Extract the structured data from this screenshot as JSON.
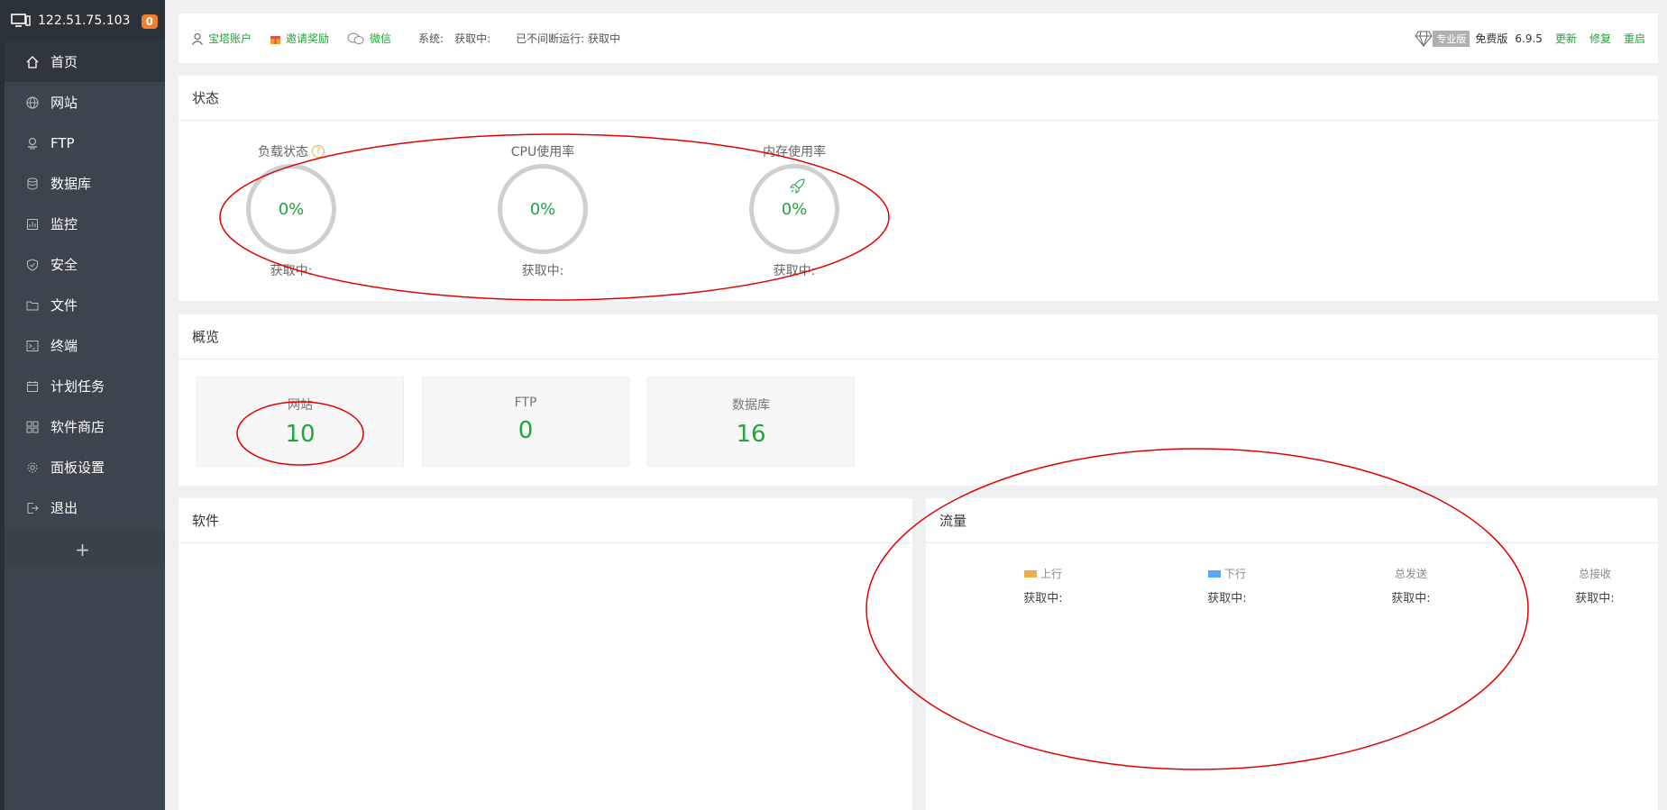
{
  "sidebar": {
    "ip": "122.51.75.103",
    "badge": "0",
    "items": [
      {
        "label": "首页",
        "icon": "home-icon"
      },
      {
        "label": "网站",
        "icon": "globe-icon"
      },
      {
        "label": "FTP",
        "icon": "ftp-icon"
      },
      {
        "label": "数据库",
        "icon": "database-icon"
      },
      {
        "label": "监控",
        "icon": "monitor-icon"
      },
      {
        "label": "安全",
        "icon": "shield-icon"
      },
      {
        "label": "文件",
        "icon": "folder-icon"
      },
      {
        "label": "终端",
        "icon": "terminal-icon"
      },
      {
        "label": "计划任务",
        "icon": "calendar-icon"
      },
      {
        "label": "软件商店",
        "icon": "apps-icon"
      },
      {
        "label": "面板设置",
        "icon": "gear-icon"
      },
      {
        "label": "退出",
        "icon": "logout-icon"
      }
    ],
    "add_label": "+"
  },
  "topbar": {
    "account": "宝塔账户",
    "invite": "邀请奖励",
    "wechat": "微信",
    "system_label": "系统:",
    "system_value": "获取中:",
    "uptime": "已不间断运行: 获取中",
    "pro": "专业版",
    "free": "免费版",
    "version": "6.9.5",
    "update": "更新",
    "repair": "修复",
    "restart": "重启"
  },
  "status": {
    "title": "状态",
    "gauges": [
      {
        "title": "负载状态",
        "value": "0%",
        "sub": "获取中:"
      },
      {
        "title": "CPU使用率",
        "value": "0%",
        "sub": "获取中:"
      },
      {
        "title": "内存使用率",
        "value": "0%",
        "sub": "获取中:"
      }
    ]
  },
  "overview": {
    "title": "概览",
    "cards": [
      {
        "label": "网站",
        "value": "10"
      },
      {
        "label": "FTP",
        "value": "0"
      },
      {
        "label": "数据库",
        "value": "16"
      }
    ]
  },
  "software": {
    "title": "软件"
  },
  "traffic": {
    "title": "流量",
    "cols": [
      {
        "label": "上行",
        "value": "获取中:",
        "color": "#f0ad4e"
      },
      {
        "label": "下行",
        "value": "获取中:",
        "color": "#52a9ff"
      },
      {
        "label": "总发送",
        "value": "获取中:"
      },
      {
        "label": "总接收",
        "value": "获取中:"
      }
    ]
  },
  "colors": {
    "accent": "#20a53a",
    "annotation": "#e00000"
  }
}
